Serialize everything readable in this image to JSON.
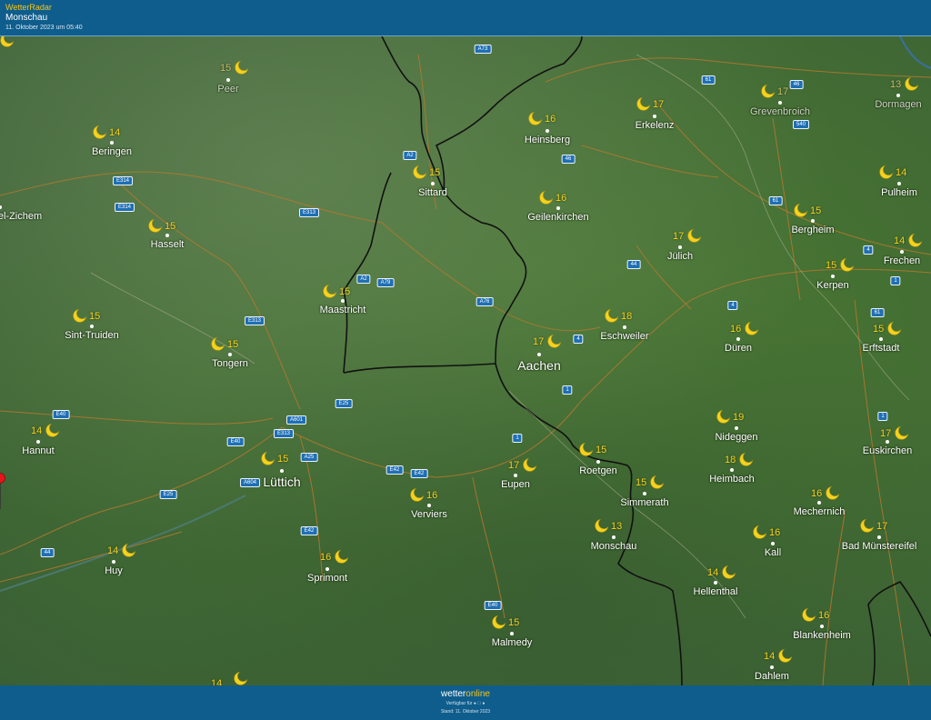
{
  "header": {
    "title": "WetterRadar",
    "place": "Monschau",
    "datetime": "11. Oktober 2023 um 05:40"
  },
  "footer": {
    "brand_main": "wetter",
    "brand_accent": "online",
    "availability": "Verfügbar für",
    "stand": "Stand: 11. Oktober 2023"
  },
  "colors": {
    "bar": "#0f5d8c",
    "moon": "#f5d21e",
    "pin": "#e4161b",
    "road_sign": "#1f6fb4"
  },
  "weather_icon": "crescent-moon-icon",
  "marker_icon": "map-pin-icon",
  "selected_location": "Monschau",
  "cities": [
    {
      "name": "Peer",
      "temp": "15"
    },
    {
      "name": "Beringen",
      "temp": "14"
    },
    {
      "name": "el-Zichem",
      "temp": ""
    },
    {
      "name": "Hasselt",
      "temp": "15"
    },
    {
      "name": "Sint-Truiden",
      "temp": "15"
    },
    {
      "name": "Tongern",
      "temp": "15"
    },
    {
      "name": "Hannut",
      "temp": "14"
    },
    {
      "name": "Lüttich",
      "temp": "15"
    },
    {
      "name": "Huy",
      "temp": "14"
    },
    {
      "name": "Sprimont",
      "temp": "16"
    },
    {
      "name": "Verviers",
      "temp": "16"
    },
    {
      "name": "Malmedy",
      "temp": "15"
    },
    {
      "name": "Eupen",
      "temp": "17"
    },
    {
      "name": "Maastricht",
      "temp": "15"
    },
    {
      "name": "Sittard",
      "temp": "15"
    },
    {
      "name": "Heinsberg",
      "temp": "16"
    },
    {
      "name": "Geilenkirchen",
      "temp": "16"
    },
    {
      "name": "Erkelenz",
      "temp": "17"
    },
    {
      "name": "Grevenbroich",
      "temp": "17"
    },
    {
      "name": "Dormagen",
      "temp": "13"
    },
    {
      "name": "Pulheim",
      "temp": "14"
    },
    {
      "name": "Bergheim",
      "temp": "15"
    },
    {
      "name": "Frechen",
      "temp": "14"
    },
    {
      "name": "Kerpen",
      "temp": "15"
    },
    {
      "name": "Jülich",
      "temp": "17"
    },
    {
      "name": "Eschweiler",
      "temp": "18"
    },
    {
      "name": "Aachen",
      "temp": "17"
    },
    {
      "name": "Düren",
      "temp": "16"
    },
    {
      "name": "Erftstadt",
      "temp": "15"
    },
    {
      "name": "Nideggen",
      "temp": "19"
    },
    {
      "name": "Heimbach",
      "temp": "18"
    },
    {
      "name": "Euskirchen",
      "temp": "17"
    },
    {
      "name": "Roetgen",
      "temp": "15"
    },
    {
      "name": "Simmerath",
      "temp": "15"
    },
    {
      "name": "Monschau",
      "temp": "13"
    },
    {
      "name": "Mechernich",
      "temp": "16"
    },
    {
      "name": "Kall",
      "temp": "16"
    },
    {
      "name": "Bad Münstereifel",
      "temp": "17"
    },
    {
      "name": "Hellenthal",
      "temp": "14"
    },
    {
      "name": "Blankenheim",
      "temp": "16"
    },
    {
      "name": "Dahlem",
      "temp": "14"
    }
  ],
  "extra_temps": [
    "14"
  ],
  "roads": [
    "A73",
    "61",
    "46",
    "540",
    "A2",
    "46",
    "E314",
    "E313",
    "E314",
    "61",
    "4",
    "44",
    "1",
    "A2",
    "A79",
    "A76",
    "4",
    "4",
    "61",
    "E313",
    "1",
    "E25",
    "A601",
    "E313",
    "E40",
    "A25",
    "A604",
    "E40",
    "E42",
    "E42",
    "E25",
    "E42",
    "44",
    "E40",
    "1",
    "1"
  ]
}
